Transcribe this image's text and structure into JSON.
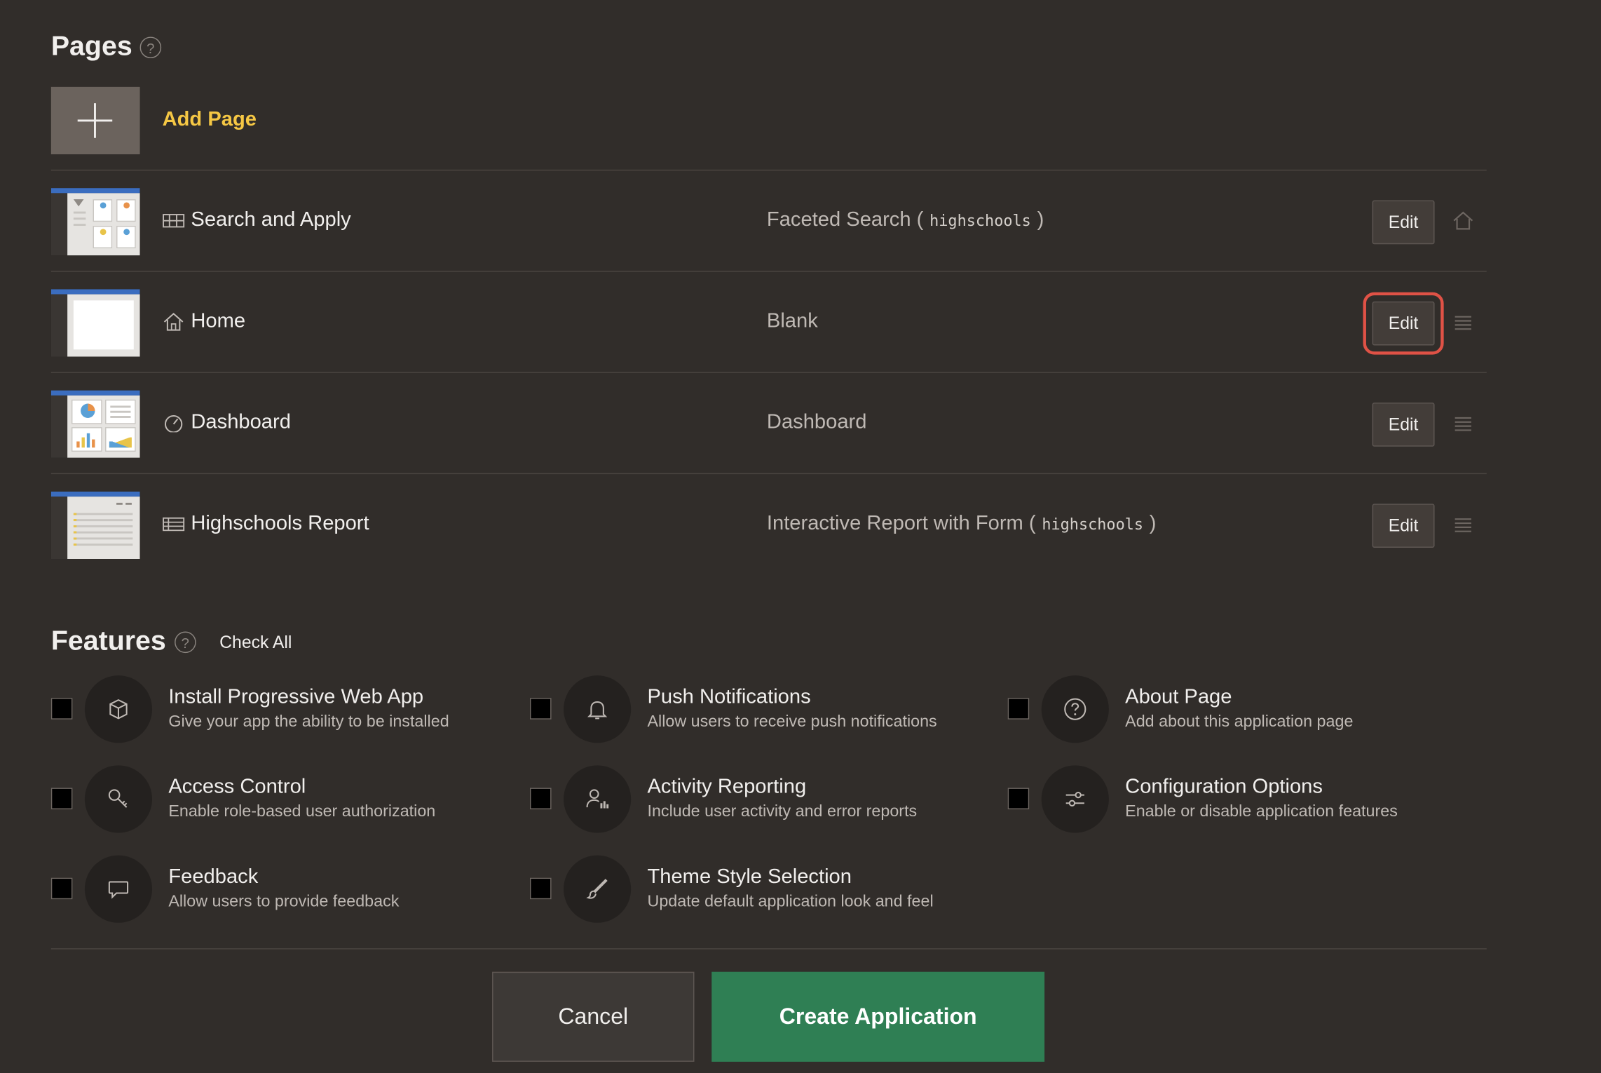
{
  "pages_section": {
    "title": "Pages",
    "help": "?",
    "add_page_label": "Add Page",
    "rows": [
      {
        "name": "Search and Apply",
        "type": "Faceted Search (",
        "table": "highschools",
        "type_close": ")",
        "edit": "Edit",
        "icon": "faceted-search-icon",
        "action_icon": "home-icon"
      },
      {
        "name": "Home",
        "type": "Blank",
        "table": "",
        "type_close": "",
        "edit": "Edit",
        "icon": "home-icon",
        "action_icon": "drag-handle-icon"
      },
      {
        "name": "Dashboard",
        "type": "Dashboard",
        "table": "",
        "type_close": "",
        "edit": "Edit",
        "icon": "dashboard-icon",
        "action_icon": "drag-handle-icon"
      },
      {
        "name": "Highschools Report",
        "type": "Interactive Report with Form (",
        "table": "highschools",
        "type_close": ")",
        "edit": "Edit",
        "icon": "report-icon",
        "action_icon": "drag-handle-icon"
      }
    ]
  },
  "features_section": {
    "title": "Features",
    "help": "?",
    "check_all": "Check All",
    "items": [
      {
        "title": "Install Progressive Web App",
        "desc": "Give your app the ability to be installed",
        "icon": "package-icon"
      },
      {
        "title": "Push Notifications",
        "desc": "Allow users to receive push notifications",
        "icon": "bell-icon"
      },
      {
        "title": "About Page",
        "desc": "Add about this application page",
        "icon": "question-icon"
      },
      {
        "title": "Access Control",
        "desc": "Enable role-based user authorization",
        "icon": "key-icon"
      },
      {
        "title": "Activity Reporting",
        "desc": "Include user activity and error reports",
        "icon": "user-chart-icon"
      },
      {
        "title": "Configuration Options",
        "desc": "Enable or disable application features",
        "icon": "sliders-icon"
      },
      {
        "title": "Feedback",
        "desc": "Allow users to provide feedback",
        "icon": "chat-bubble-icon"
      },
      {
        "title": "Theme Style Selection",
        "desc": "Update default application look and feel",
        "icon": "brush-icon"
      }
    ]
  },
  "footer": {
    "cancel": "Cancel",
    "create": "Create Application"
  },
  "colors": {
    "background": "#312d2a",
    "accent_yellow": "#f5c744",
    "create_green": "#2f7f54",
    "highlight_red": "#e05246"
  }
}
